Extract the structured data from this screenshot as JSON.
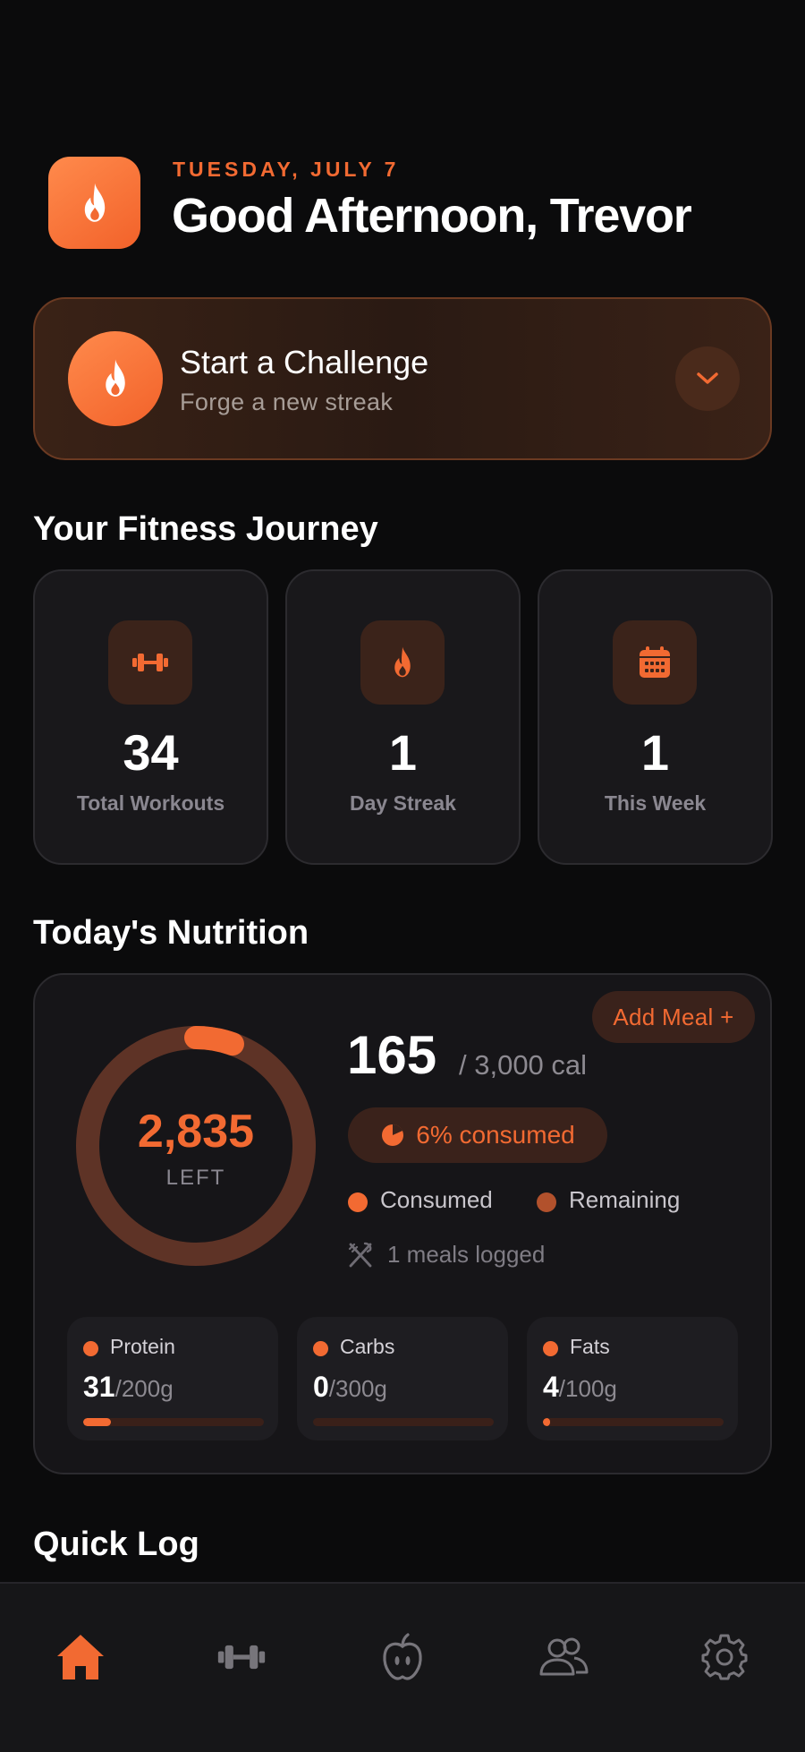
{
  "header": {
    "date": "TUESDAY, JULY 7",
    "greeting": "Good Afternoon, Trevor"
  },
  "challenge": {
    "title": "Start a Challenge",
    "subtitle": "Forge a new streak"
  },
  "journey": {
    "title": "Your Fitness Journey",
    "stats": [
      {
        "icon": "dumbbell-icon",
        "value": "34",
        "label": "Total Workouts"
      },
      {
        "icon": "flame-icon",
        "value": "1",
        "label": "Day Streak"
      },
      {
        "icon": "calendar-icon",
        "value": "1",
        "label": "This Week"
      }
    ]
  },
  "nutrition": {
    "title": "Today's Nutrition",
    "add_meal_label": "Add Meal +",
    "calories_left": "2,835",
    "left_label": "LEFT",
    "calories_consumed": "165",
    "calories_total": "/ 3,000 cal",
    "percent_consumed_label": "6% consumed",
    "percent_consumed": 0.055,
    "legend": {
      "consumed": "Consumed",
      "remaining": "Remaining"
    },
    "meals_logged": "1 meals logged",
    "macros": [
      {
        "name": "Protein",
        "current": "31",
        "target": "/200g",
        "fraction": 0.155
      },
      {
        "name": "Carbs",
        "current": "0",
        "target": "/300g",
        "fraction": 0.0
      },
      {
        "name": "Fats",
        "current": "4",
        "target": "/100g",
        "fraction": 0.04
      }
    ]
  },
  "quick_log": {
    "title": "Quick Log"
  },
  "nav": {
    "items": [
      {
        "icon": "home-icon",
        "active": true
      },
      {
        "icon": "dumbbell-icon",
        "active": false
      },
      {
        "icon": "apple-icon",
        "active": false
      },
      {
        "icon": "users-icon",
        "active": false
      },
      {
        "icon": "gear-icon",
        "active": false
      }
    ]
  },
  "colors": {
    "accent": "#f26a32",
    "background": "#0b0b0c",
    "card": "#19181b",
    "ring_remaining": "#6b3a2a"
  }
}
